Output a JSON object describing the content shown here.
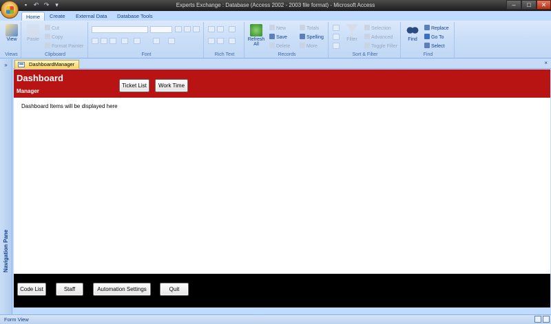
{
  "window": {
    "title": "Experts Exchange : Database (Access 2002 - 2003 file format) - Microsoft Access"
  },
  "ribbon_tabs": [
    {
      "label": "Home",
      "active": true
    },
    {
      "label": "Create",
      "active": false
    },
    {
      "label": "External Data",
      "active": false
    },
    {
      "label": "Database Tools",
      "active": false
    }
  ],
  "ribbon": {
    "views": {
      "view_label": "View",
      "group_label": "Views"
    },
    "clipboard": {
      "paste_label": "Paste",
      "cut_label": "Cut",
      "copy_label": "Copy",
      "format_painter_label": "Format Painter",
      "group_label": "Clipboard"
    },
    "font": {
      "group_label": "Font"
    },
    "rich_text": {
      "group_label": "Rich Text"
    },
    "records": {
      "refresh_label": "Refresh",
      "refresh_sub": "All",
      "new_label": "New",
      "save_label": "Save",
      "delete_label": "Delete",
      "totals_label": "Totals",
      "spelling_label": "Spelling",
      "more_label": "More",
      "group_label": "Records"
    },
    "sort_filter": {
      "filter_label": "Filter",
      "selection_label": "Selection",
      "advanced_label": "Advanced",
      "toggle_filter_label": "Toggle Filter",
      "group_label": "Sort & Filter"
    },
    "find": {
      "find_label": "Find",
      "replace_label": "Replace",
      "goto_label": "Go To",
      "select_label": "Select",
      "group_label": "Find"
    }
  },
  "nav_pane": {
    "label": "Navigation Pane",
    "toggle_glyph": "»"
  },
  "document_tab": {
    "label": "DashboardManager",
    "close_glyph": "×"
  },
  "form": {
    "title": "Dashboard",
    "subtitle": "Manager",
    "header_buttons": {
      "ticket_list": "Ticket List",
      "work_time": "Work Time"
    },
    "detail_text": "Dashboard Items will be displayed here",
    "footer_buttons": {
      "code_list": "Code List",
      "staff": "Staff",
      "automation_settings": "Automation Settings",
      "quit": "Quit"
    }
  },
  "status_bar": {
    "text": "Form View"
  },
  "colors": {
    "header_red": "#b81414",
    "footer_black": "#000000",
    "ribbon_blue": "#bfdbff"
  }
}
